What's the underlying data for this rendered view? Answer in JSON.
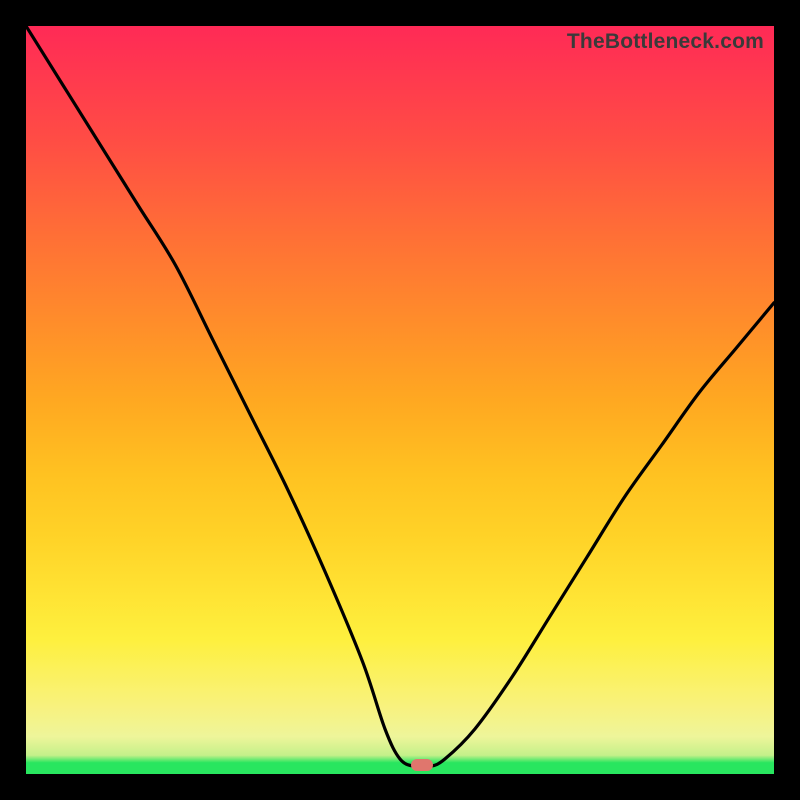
{
  "watermark": "TheBottleneck.com",
  "chart_data": {
    "type": "line",
    "title": "",
    "xlabel": "",
    "ylabel": "",
    "xlim": [
      0,
      100
    ],
    "ylim": [
      0,
      100
    ],
    "grid": false,
    "series": [
      {
        "name": "curve",
        "x": [
          0,
          5,
          10,
          15,
          20,
          25,
          30,
          35,
          40,
          45,
          48,
          50,
          52,
          54,
          56,
          60,
          65,
          70,
          75,
          80,
          85,
          90,
          95,
          100
        ],
        "values": [
          100,
          92,
          84,
          76,
          68,
          58,
          48,
          38,
          27,
          15,
          6,
          2,
          1,
          1,
          2,
          6,
          13,
          21,
          29,
          37,
          44,
          51,
          57,
          63
        ]
      }
    ],
    "marker": {
      "x": 53,
      "y": 1.2
    },
    "background_gradient": {
      "top": "#ff2a56",
      "mid_high": "#ffa821",
      "mid": "#fef03e",
      "mid_low": "#eef59a",
      "bottom": "#28e65f"
    }
  }
}
